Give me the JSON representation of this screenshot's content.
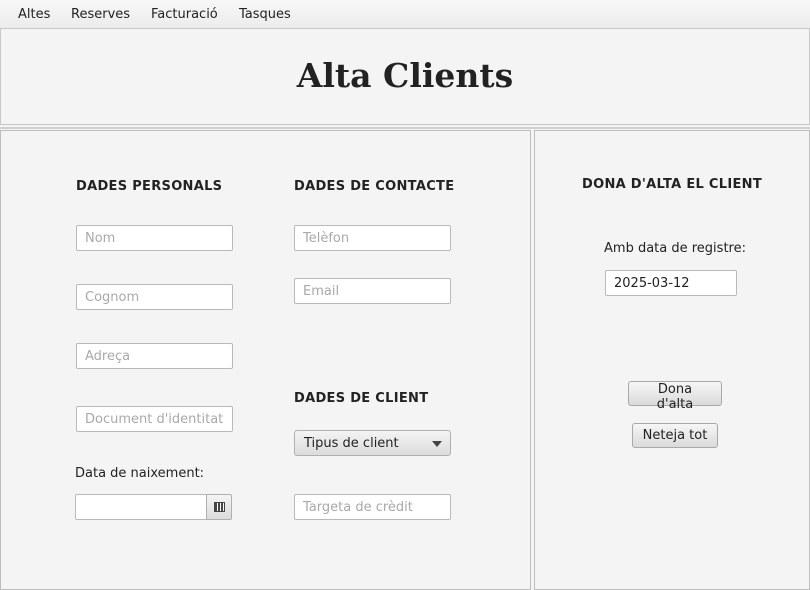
{
  "menubar": {
    "items": [
      {
        "label": "Altes"
      },
      {
        "label": "Reserves"
      },
      {
        "label": "Facturació"
      },
      {
        "label": "Tasques"
      }
    ]
  },
  "header": {
    "title": "Alta Clients"
  },
  "personal": {
    "heading": "DADES PERSONALS",
    "name_placeholder": "Nom",
    "surname_placeholder": "Cognom",
    "address_placeholder": "Adreça",
    "id_document_placeholder": "Document d'identitat",
    "birthdate_label": "Data de naixement:",
    "birthdate_value": ""
  },
  "contact": {
    "heading": "DADES DE CONTACTE",
    "phone_placeholder": "Telèfon",
    "email_placeholder": "Email"
  },
  "client": {
    "heading": "DADES DE CLIENT",
    "client_type_selected": "Tipus de client",
    "credit_card_placeholder": "Targeta de crèdit"
  },
  "register": {
    "heading": "DONA D'ALTA EL CLIENT",
    "date_label": "Amb data de registre:",
    "date_value": "2025-03-12",
    "register_button": "Dona d'alta",
    "clear_button": "Neteja tot"
  },
  "icons": {
    "calendar": "calendar-icon",
    "dropdown": "chevron-down-icon"
  }
}
